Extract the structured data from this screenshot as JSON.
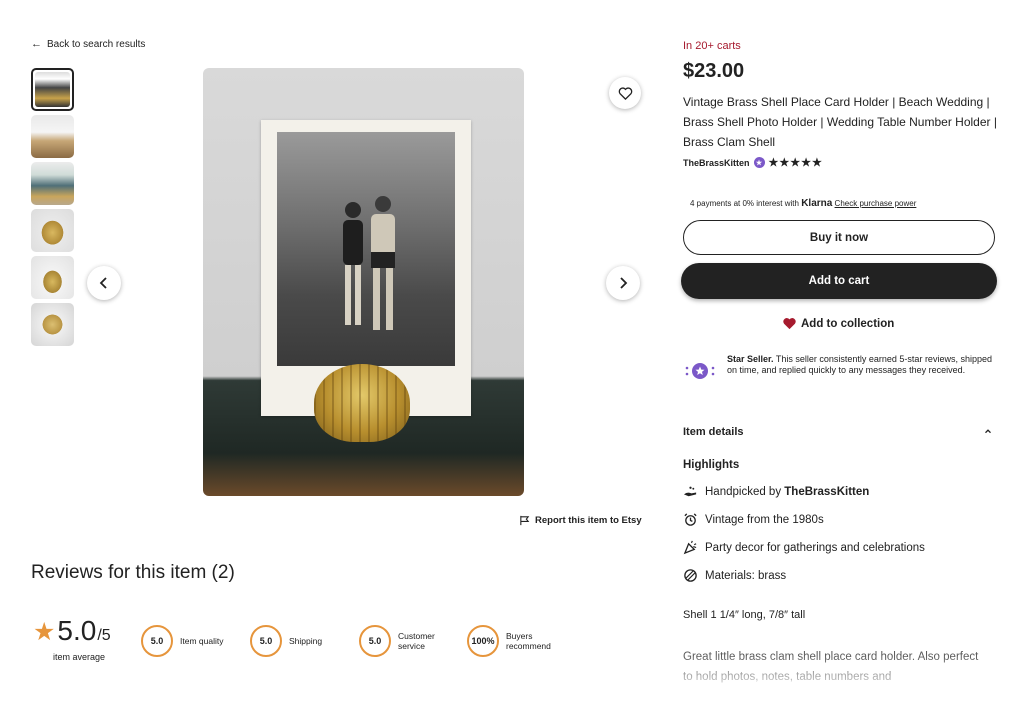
{
  "back_link": "Back to search results",
  "report_link": "Report this item to Etsy",
  "reviews": {
    "title": "Reviews for this item (2)",
    "average": "5.0",
    "out_of": "/5",
    "average_label": "item average",
    "metrics": [
      {
        "score": "5.0",
        "label": "Item quality"
      },
      {
        "score": "5.0",
        "label": "Shipping"
      },
      {
        "score": "5.0",
        "label": "Customer service"
      },
      {
        "score": "100%",
        "label": "Buyers recommend"
      }
    ]
  },
  "product": {
    "carts": "In 20+ carts",
    "price": "$23.00",
    "title": "Vintage Brass Shell Place Card Holder | Beach Wedding | Brass Shell Photo Holder | Wedding Table Number Holder | Brass Clam Shell",
    "seller": "TheBrassKitten",
    "rating_stars": "★★★★★",
    "klarna_text": "4 payments at 0% interest with",
    "klarna_brand": "Klarna",
    "klarna_link": "Check purchase power",
    "buy_now": "Buy it now",
    "add_to_cart": "Add to cart",
    "add_to_collection": "Add to collection",
    "star_seller_bold": "Star Seller.",
    "star_seller_text": "This seller consistently earned 5-star reviews, shipped on time, and replied quickly to any messages they received.",
    "item_details": "Item details",
    "highlights_title": "Highlights",
    "highlights": [
      {
        "prefix": "Handpicked by ",
        "bold": "TheBrassKitten",
        "icon": "hand-icon"
      },
      {
        "prefix": "Vintage from the 1980s",
        "bold": "",
        "icon": "alarm-clock-icon"
      },
      {
        "prefix": "Party decor for gatherings and celebrations",
        "bold": "",
        "icon": "party-popper-icon"
      },
      {
        "prefix": "Materials: brass",
        "bold": "",
        "icon": "materials-icon"
      }
    ],
    "desc_line1": "Shell 1 1/4″ long, 7/8″ tall",
    "desc_para": "Great little brass clam shell place card holder. Also perfect to hold photos, notes, table numbers and"
  },
  "colors": {
    "accent": "#e6953c",
    "carts": "#a61a2e",
    "primary": "#222222",
    "star_seller": "#7b58c8"
  }
}
